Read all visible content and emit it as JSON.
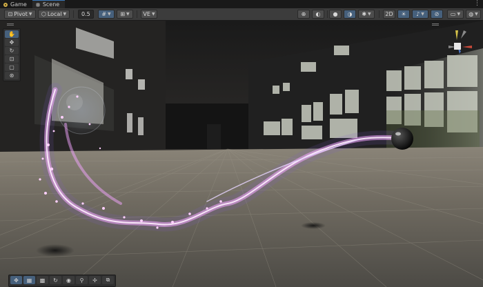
{
  "tabs": [
    {
      "label": "Game",
      "icon": "game-icon",
      "active": false
    },
    {
      "label": "Scene",
      "icon": "grid-icon",
      "active": true
    }
  ],
  "toolbar": {
    "pivot_label": "Pivot",
    "local_label": "Local",
    "snap_value": "0.5",
    "ve_label": "VE",
    "twod_label": "2D"
  },
  "scene_tools": [
    "hand-tool",
    "move-tool",
    "rotate-tool",
    "scale-tool",
    "rect-tool",
    "transform-tool"
  ],
  "overlay_tools": [
    "move-overlay",
    "shapes-overlay",
    "paint-overlay",
    "rotate-overlay",
    "sphere-overlay",
    "search-overlay",
    "transform-overlay",
    "box-overlay"
  ],
  "colors": {
    "accent": "#46607c",
    "panel": "#3c3c3c",
    "trail": "#f3a6ff"
  }
}
